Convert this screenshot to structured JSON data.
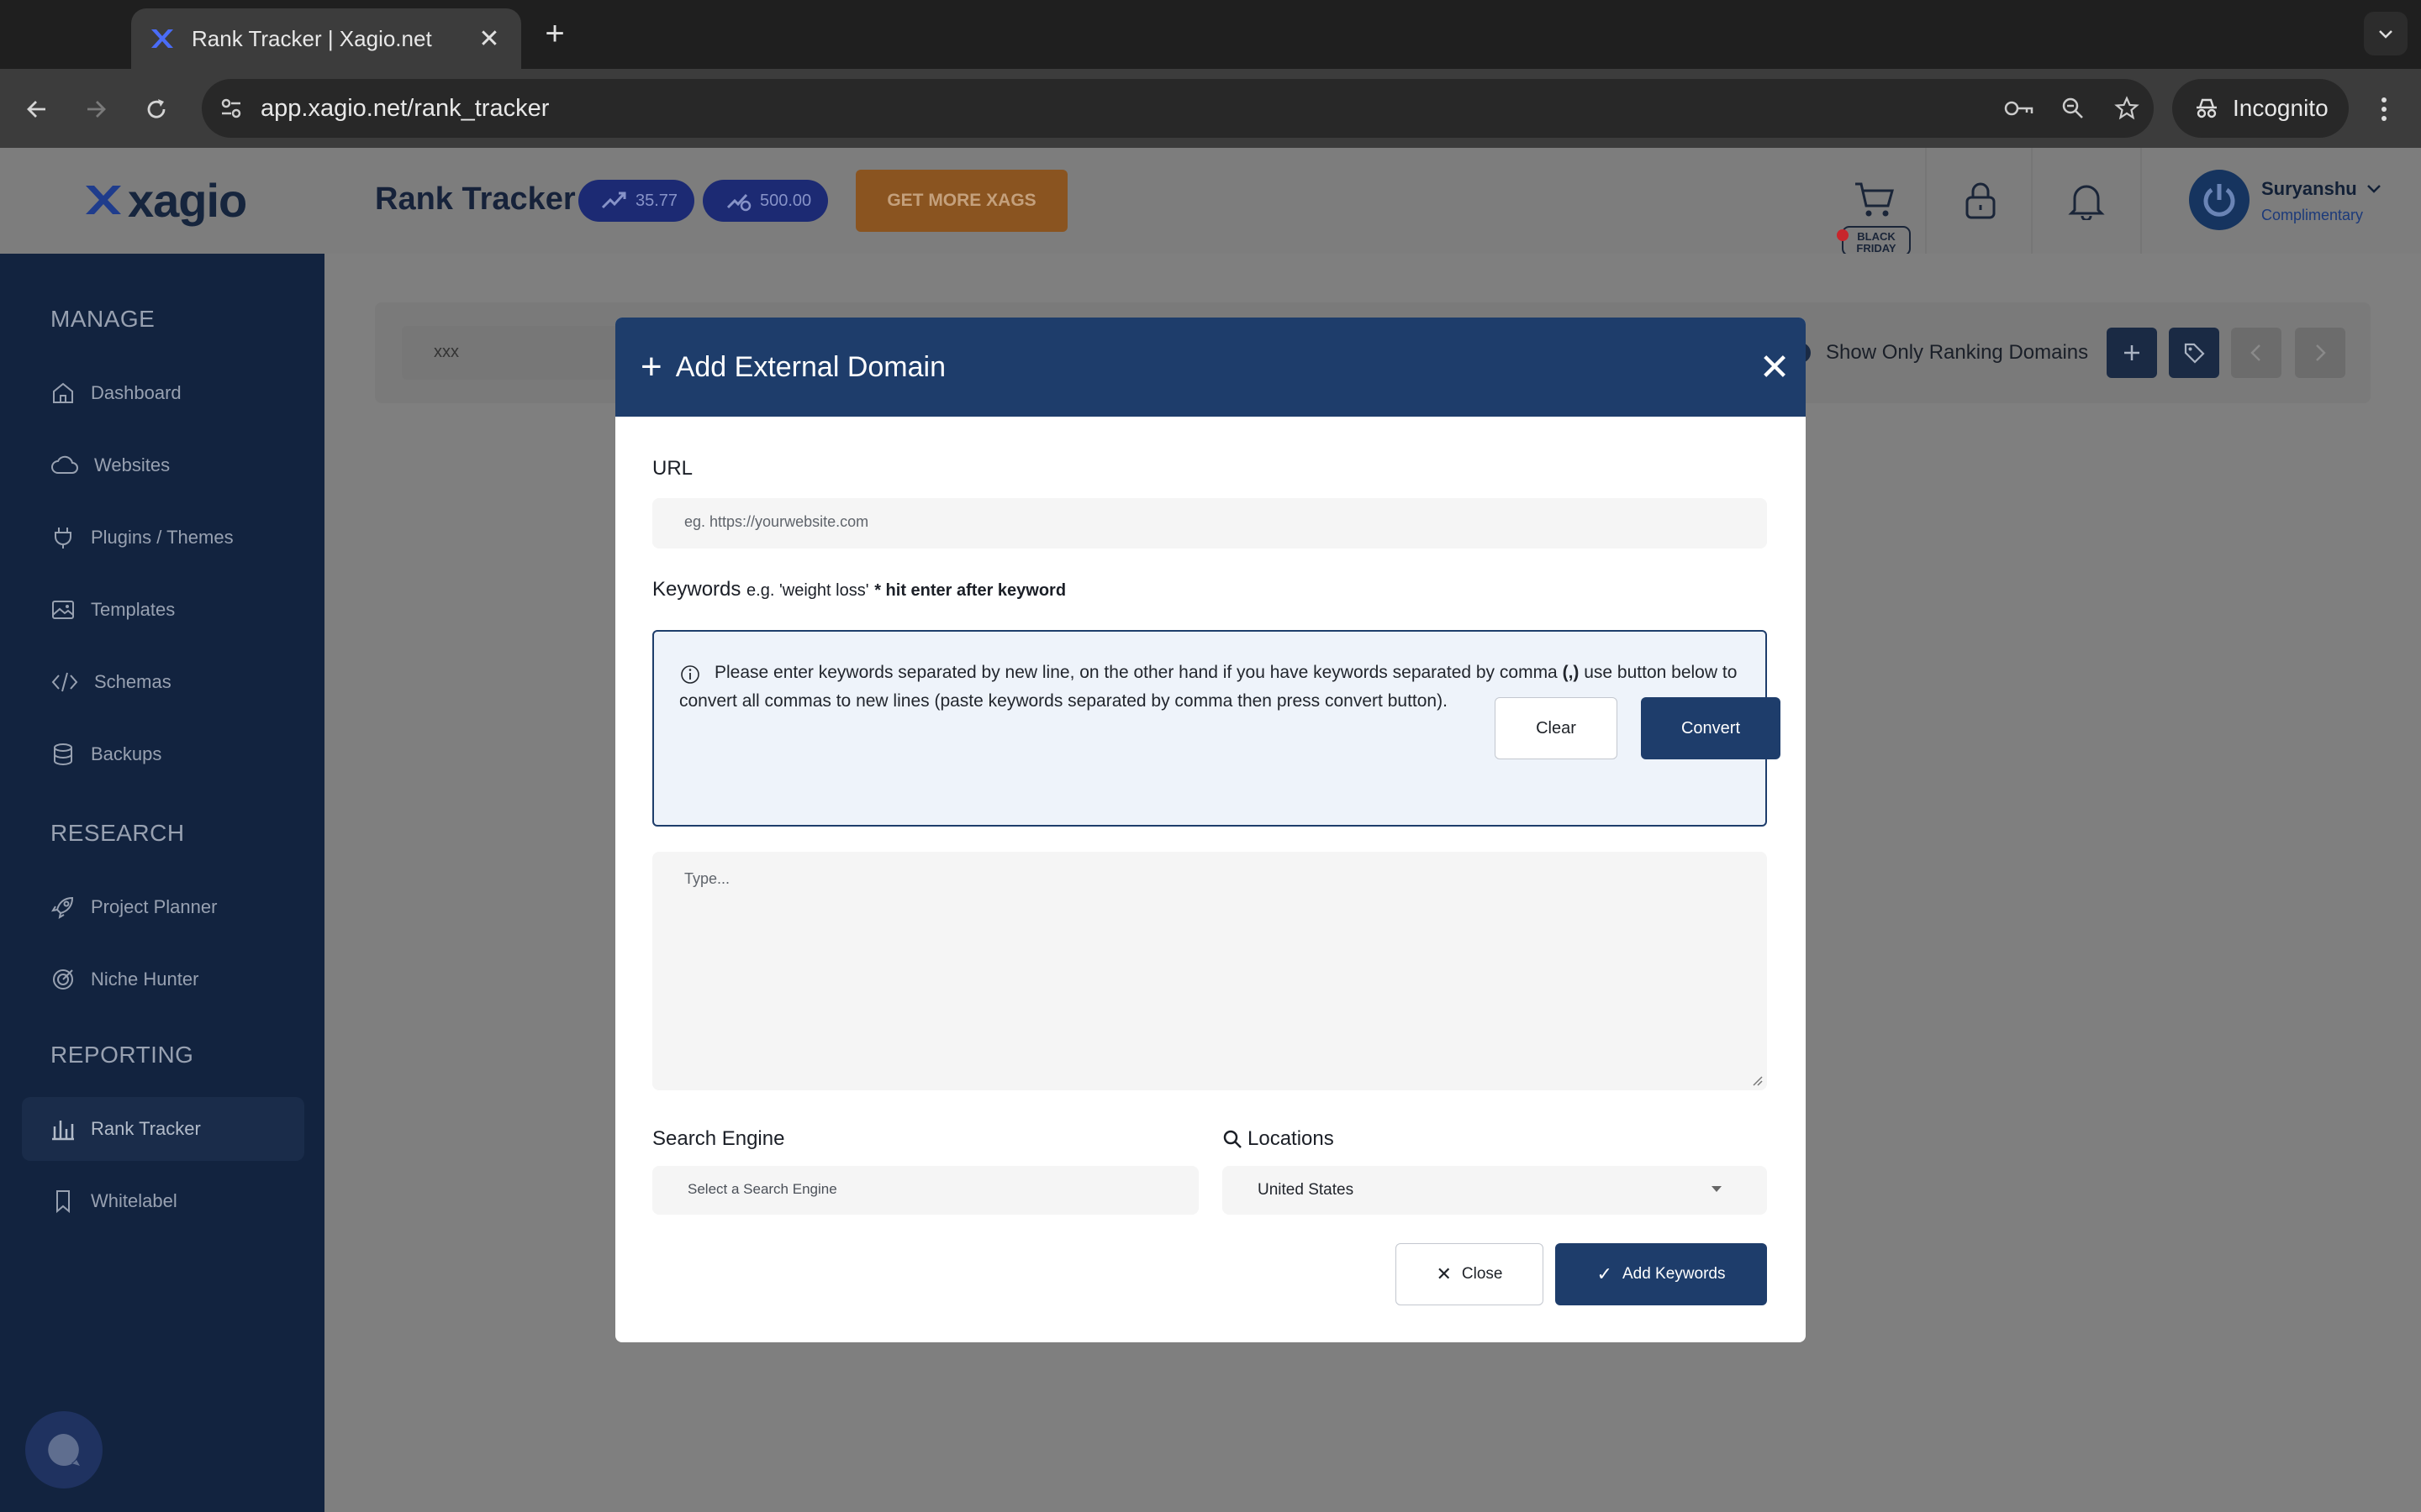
{
  "browser": {
    "tab_title": "Rank Tracker | Xagio.net",
    "tab_close": "✕",
    "new_tab": "+",
    "url": "app.xagio.net/rank_tracker",
    "incognito_label": "Incognito"
  },
  "header": {
    "logo_text": "xagio",
    "page_title": "Rank Tracker",
    "xags_balance_1": "35.77",
    "xags_balance_2": "500.00",
    "get_more_label": "GET MORE XAGS",
    "user_name": "Suryanshu",
    "user_plan": "Complimentary"
  },
  "sidebar": {
    "sections": [
      {
        "title": "MANAGE",
        "items": [
          {
            "label": "Dashboard",
            "icon": "home-icon"
          },
          {
            "label": "Websites",
            "icon": "cloud-icon"
          },
          {
            "label": "Plugins / Themes",
            "icon": "plug-icon"
          },
          {
            "label": "Templates",
            "icon": "image-icon"
          },
          {
            "label": "Schemas",
            "icon": "code-icon"
          },
          {
            "label": "Backups",
            "icon": "database-icon"
          }
        ]
      },
      {
        "title": "RESEARCH",
        "items": [
          {
            "label": "Project Planner",
            "icon": "rocket-icon"
          },
          {
            "label": "Niche Hunter",
            "icon": "target-icon"
          }
        ]
      },
      {
        "title": "REPORTING",
        "items": [
          {
            "label": "Rank Tracker",
            "icon": "bar-chart-icon",
            "active": true
          },
          {
            "label": "Whitelabel",
            "icon": "bookmark-icon"
          }
        ]
      }
    ]
  },
  "toolbar": {
    "filter_value": "xxx",
    "show_only_ranking_label": "Show Only Ranking Domains"
  },
  "modal": {
    "plus": "+",
    "title": "Add External Domain",
    "close_x": "✕",
    "url_label": "URL",
    "url_placeholder": "eg. https://yourwebsite.com",
    "keywords_label": "Keywords",
    "keywords_example": "e.g. 'weight loss'",
    "keywords_hint": "* hit enter after keyword",
    "info_text_1": "Please enter keywords separated by new line, on the other hand if you have keywords separated by comma ",
    "info_comma": "(,)",
    "info_text_2": " use button below to convert all commas to new lines (paste keywords separated by comma then press convert button).",
    "clear_label": "Clear",
    "convert_label": "Convert",
    "keywords_placeholder": "Type...",
    "search_engine_label": "Search Engine",
    "search_engine_placeholder": "Select a Search Engine",
    "locations_label": "Locations",
    "location_value": "United States",
    "close_label": "Close",
    "close_icon_glyph": "✕",
    "add_label": "Add Keywords",
    "add_icon_glyph": "✓"
  },
  "colors": {
    "primary": "#1e3d6b",
    "sidebar": "#12233f",
    "accent_orange": "#8a5420"
  }
}
